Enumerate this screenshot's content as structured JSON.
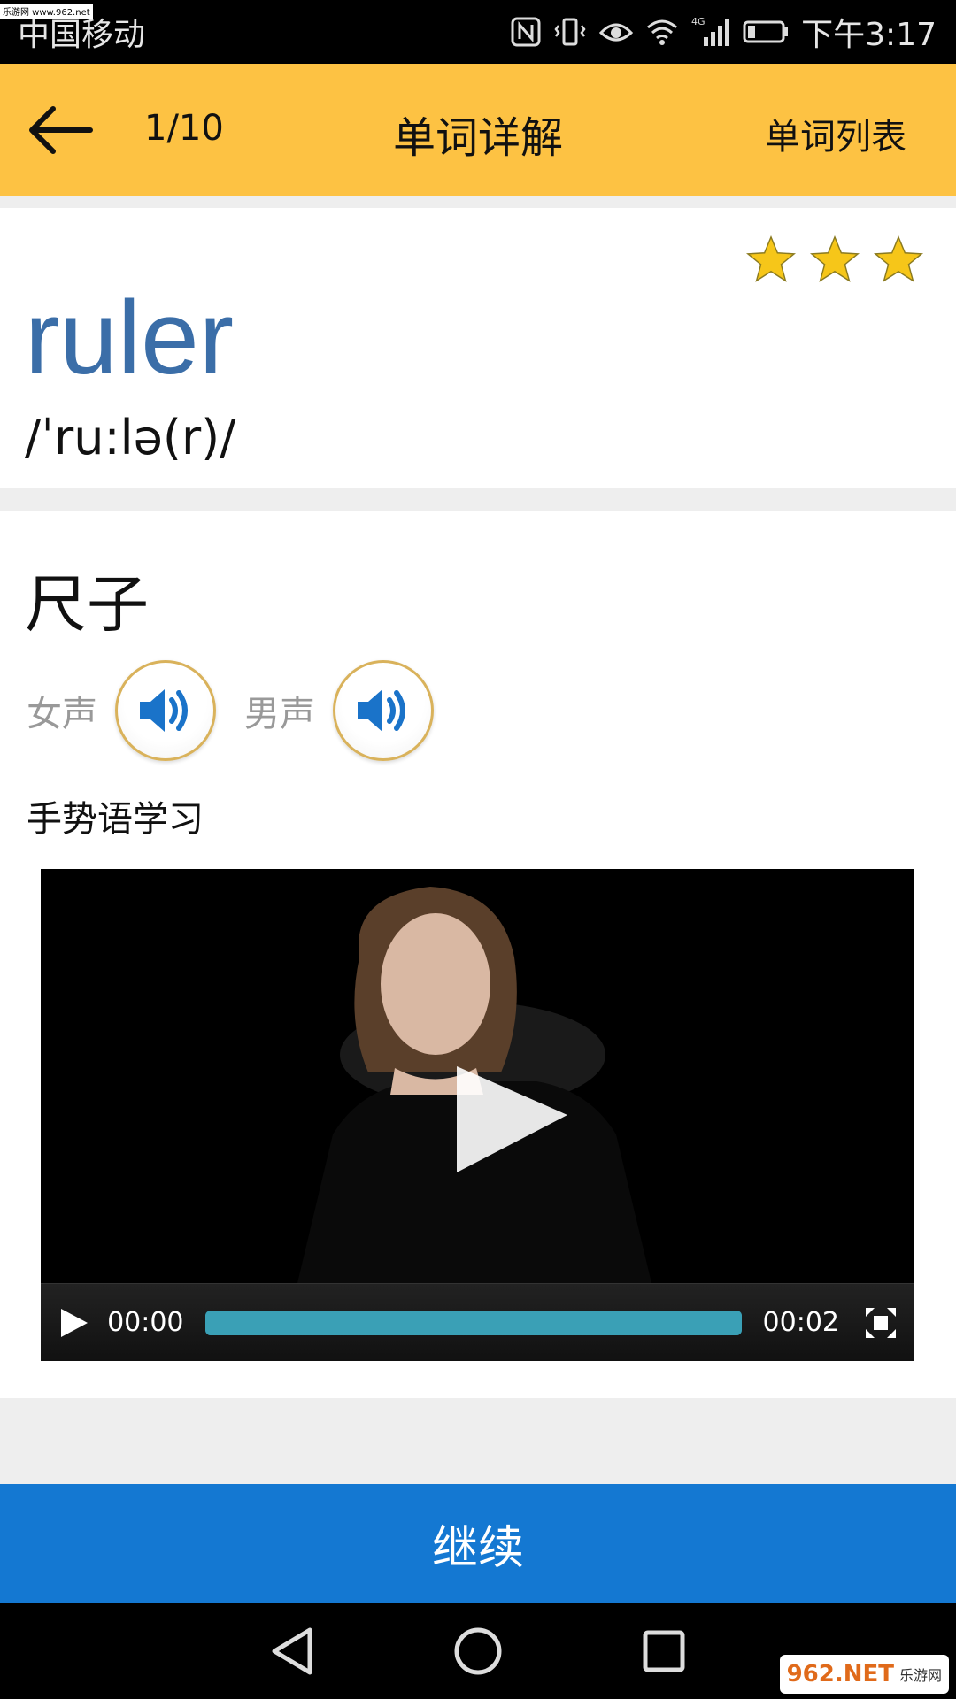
{
  "status_bar": {
    "carrier": "中国移动",
    "time": "下午3:17",
    "network": "4G",
    "watermark": "乐游网 www.962.net"
  },
  "app_bar": {
    "progress": "1/10",
    "title": "单词详解",
    "word_list": "单词列表"
  },
  "word": {
    "text": "ruler",
    "phonetic": "/ˈru:lə(r)/",
    "stars": 3,
    "star_color": "#f6c619"
  },
  "meaning": {
    "text": "尺子",
    "female_voice": "女声",
    "male_voice": "男声",
    "sign_language_title": "手势语学习"
  },
  "video": {
    "current_time": "00:00",
    "duration": "00:02",
    "progress_fraction": 1.0
  },
  "continue_button": "继续",
  "site_logo": {
    "main": "962.NET",
    "sub": "乐游网"
  },
  "colors": {
    "app_bar": "#fdc243",
    "word": "#3b6ea8",
    "continue": "#1478d2",
    "speaker": "#1a73c9"
  }
}
